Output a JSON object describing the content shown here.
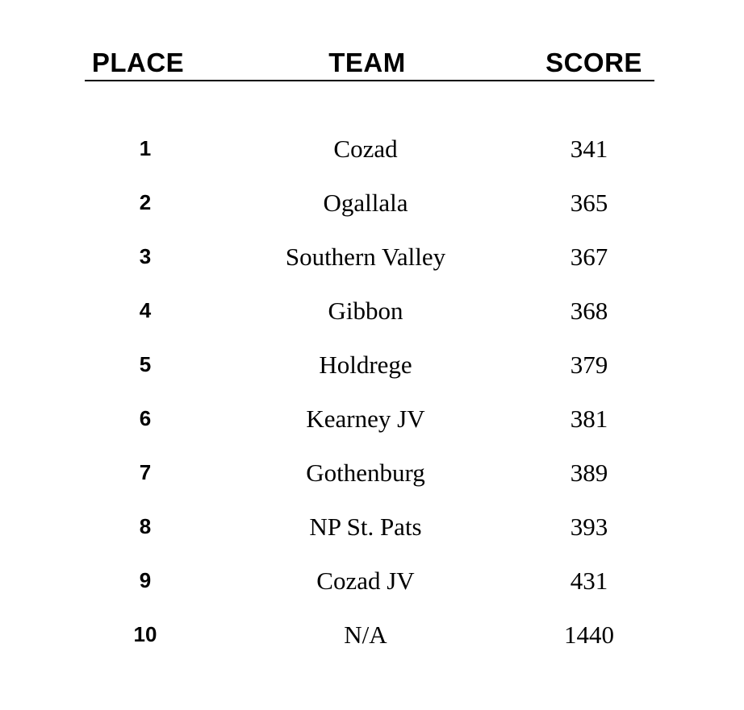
{
  "page": {
    "background_color": "#ffffff",
    "text_color": "#000000",
    "rule_color": "#000000"
  },
  "table": {
    "columns": [
      {
        "key": "place",
        "label": "PLACE"
      },
      {
        "key": "team",
        "label": "TEAM"
      },
      {
        "key": "score",
        "label": "SCORE"
      }
    ],
    "rows": [
      {
        "place": "1",
        "team": "Cozad",
        "score": "341"
      },
      {
        "place": "2",
        "team": "Ogallala",
        "score": "365"
      },
      {
        "place": "3",
        "team": "Southern Valley",
        "score": "367"
      },
      {
        "place": "4",
        "team": "Gibbon",
        "score": "368"
      },
      {
        "place": "5",
        "team": "Holdrege",
        "score": "379"
      },
      {
        "place": "6",
        "team": "Kearney JV",
        "score": "381"
      },
      {
        "place": "7",
        "team": "Gothenburg",
        "score": "389"
      },
      {
        "place": "8",
        "team": "NP St. Pats",
        "score": "393"
      },
      {
        "place": "9",
        "team": "Cozad JV",
        "score": "431"
      },
      {
        "place": "10",
        "team": "N/A",
        "score": "1440"
      }
    ]
  },
  "chart_data": {
    "type": "table",
    "title": "",
    "columns": [
      "PLACE",
      "TEAM",
      "SCORE"
    ],
    "categories": [
      "Cozad",
      "Ogallala",
      "Southern Valley",
      "Gibbon",
      "Holdrege",
      "Kearney JV",
      "Gothenburg",
      "NP St. Pats",
      "Cozad JV",
      "N/A"
    ],
    "values": [
      341,
      365,
      367,
      368,
      379,
      381,
      389,
      393,
      431,
      1440
    ],
    "places": [
      1,
      2,
      3,
      4,
      5,
      6,
      7,
      8,
      9,
      10
    ],
    "xlabel": "TEAM",
    "ylabel": "SCORE"
  }
}
